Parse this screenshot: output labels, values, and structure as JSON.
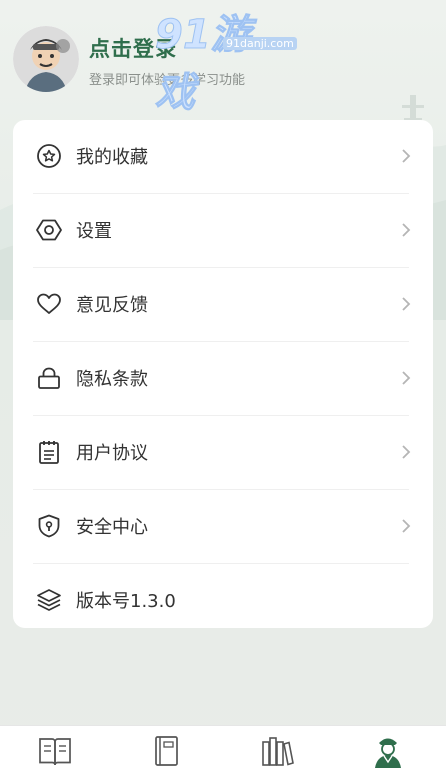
{
  "header": {
    "login_title": "点击登录",
    "login_subtitle": "登录即可体验更多学习功能",
    "watermark": {
      "logo": "91游戏",
      "url": "91danji.com"
    }
  },
  "menu": [
    {
      "icon": "star-circle-icon",
      "label": "我的收藏",
      "has_arrow": true
    },
    {
      "icon": "hexagon-settings-icon",
      "label": "设置",
      "has_arrow": true
    },
    {
      "icon": "heart-icon",
      "label": "意见反馈",
      "has_arrow": true
    },
    {
      "icon": "lock-icon",
      "label": "隐私条款",
      "has_arrow": true
    },
    {
      "icon": "notepad-icon",
      "label": "用户协议",
      "has_arrow": true
    },
    {
      "icon": "shield-icon",
      "label": "安全中心",
      "has_arrow": true
    },
    {
      "icon": "layers-icon",
      "label": "版本号1.3.0",
      "has_arrow": false
    }
  ],
  "tabbar": {
    "tabs": [
      {
        "icon": "open-book-icon"
      },
      {
        "icon": "closed-book-icon"
      },
      {
        "icon": "bookshelf-icon"
      },
      {
        "icon": "scholar-avatar-icon",
        "active": true
      }
    ]
  },
  "colors": {
    "accent": "#2f6e4c",
    "text": "#333333",
    "muted": "#8a8f8b"
  }
}
